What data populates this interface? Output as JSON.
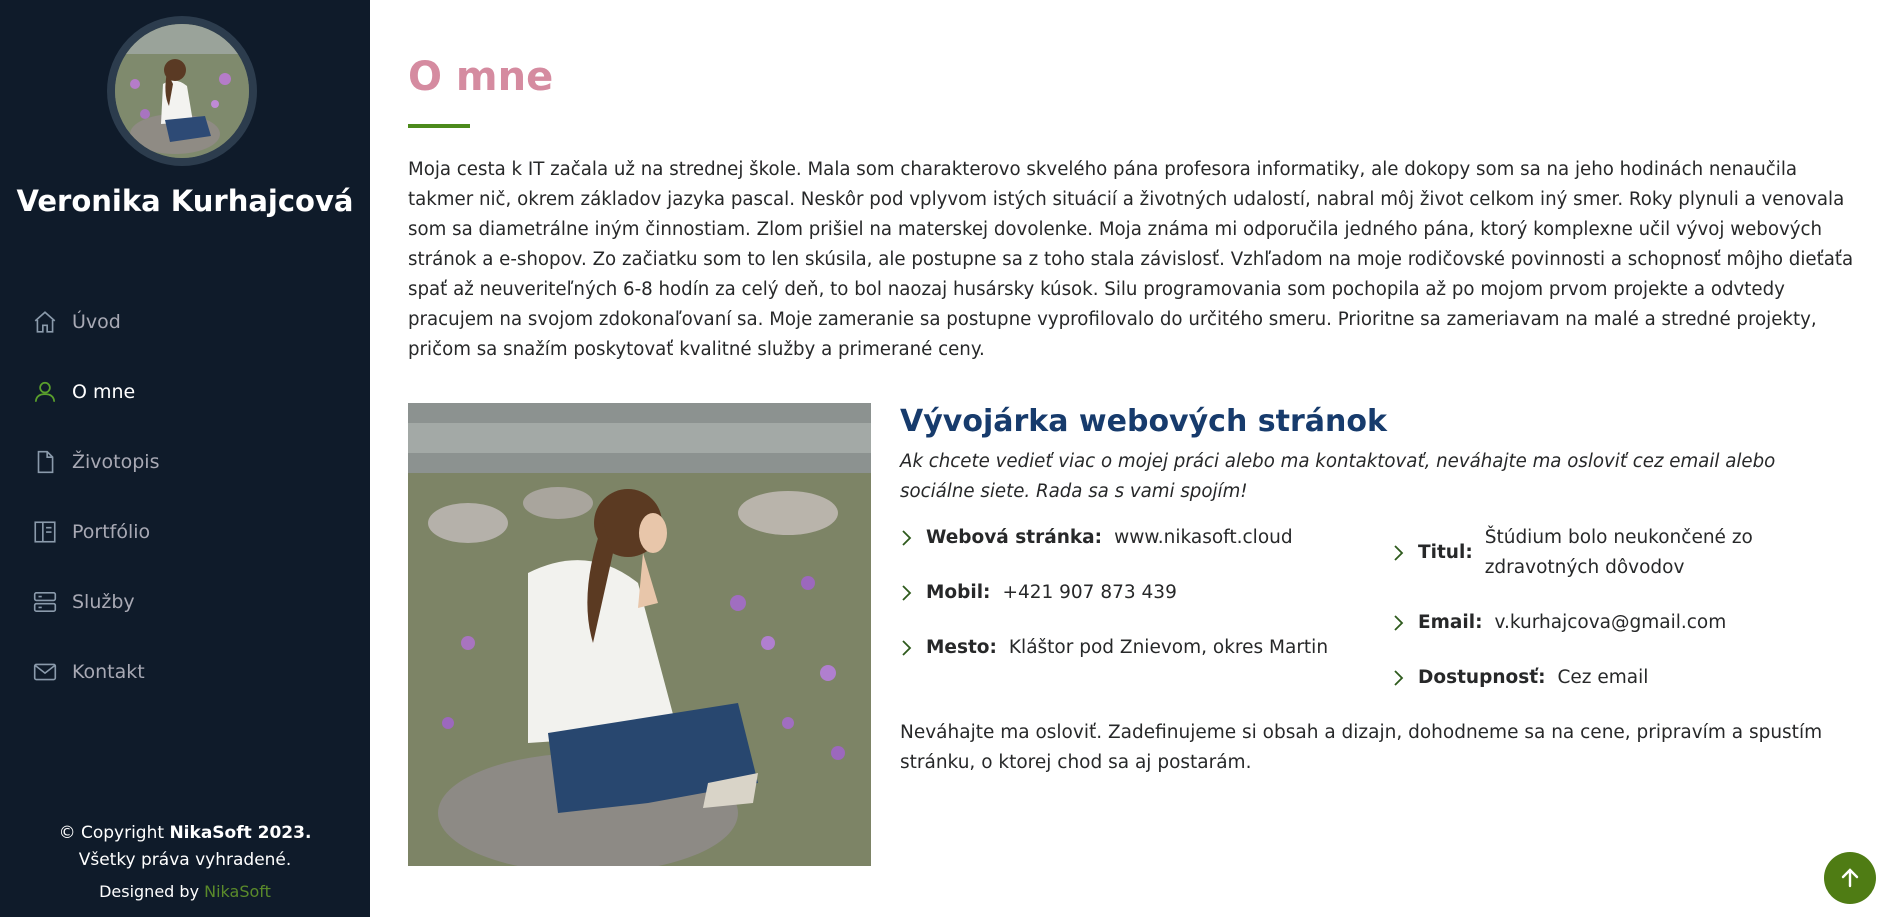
{
  "sidebar": {
    "name": "Veronika Kurhajcová",
    "nav": [
      {
        "label": "Úvod",
        "icon": "home-icon"
      },
      {
        "label": "O mne",
        "icon": "person-icon",
        "active": true
      },
      {
        "label": "Životopis",
        "icon": "file-icon"
      },
      {
        "label": "Portfólio",
        "icon": "book-icon"
      },
      {
        "label": "Služby",
        "icon": "server-icon"
      },
      {
        "label": "Kontakt",
        "icon": "envelope-icon"
      }
    ],
    "footer": {
      "copyright_prefix": "© Copyright",
      "copyright_brand": "NikaSoft 2023.",
      "rights": "Všetky práva vyhradené.",
      "designed_by": "Designed by",
      "designer": "NikaSoft"
    }
  },
  "main": {
    "title": "O mne",
    "intro": "Moja cesta k IT začala už na strednej škole. Mala som charakterovo skvelého pána profesora informatiky, ale dokopy som sa na jeho hodinách nenaučila takmer nič, okrem základov jazyka pascal. Neskôr pod vplyvom istých situácií a životných udalostí, nabral môj život celkom iný smer. Roky plynuli a venovala som sa diametrálne iným činnostiam. Zlom prišiel na materskej dovolenke. Moja známa mi odporučila jedného pána, ktorý komplexne učil vývoj webových stránok a e-shopov. Zo začiatku som to len skúsila, ale postupne sa z toho stala závislosť. Vzhľadom na moje rodičovské povinnosti a schopnosť môjho dieťaťa spať až neuveriteľných 6-8 hodín za celý deň, to bol naozaj husársky kúsok. Silu programovania som pochopila až po mojom prvom projekte a odvtedy pracujem na svojom zdokonaľovaní sa. Moje zameranie sa postupne vyprofilovalo do určitého smeru. Prioritne sa zameriavam na malé a stredné projekty, pričom sa snažím poskytovať kvalitné služby a primerané ceny.",
    "role": "Vývojárka webových stránok",
    "lead": "Ak chcete vedieť viac o mojej práci alebo ma kontaktovať, neváhajte ma osloviť cez email alebo sociálne siete. Rada sa s vami spojím!",
    "details_left": [
      {
        "label": "Webová stránka:",
        "value": "www.nikasoft.cloud"
      },
      {
        "label": "Mobil:",
        "value": "+421 907 873 439"
      },
      {
        "label": "Mesto:",
        "value": "Kláštor pod Znievom, okres Martin"
      }
    ],
    "details_right": [
      {
        "label": "Titul:",
        "value": "Štúdium bolo neukončené zo zdravotných dôvodov"
      },
      {
        "label": "Email:",
        "value": "v.kurhajcova@gmail.com"
      },
      {
        "label": "Dostupnosť:",
        "value": "Cez email"
      }
    ],
    "outro": "Neváhajte ma osloviť. Zadefinujeme si obsah a dizajn, dohodneme sa na cene, pripravím a spustím stránku, o ktorej chod sa aj postarám."
  },
  "colors": {
    "sidebar_bg": "#0f1b2a",
    "title_pink": "#d58ba0",
    "accent_green": "#4c8a1c",
    "role_blue": "#173b6c",
    "back_to_top": "#4f7c14"
  }
}
